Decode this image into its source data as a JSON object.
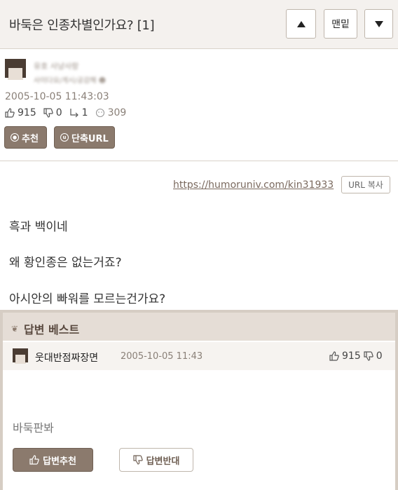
{
  "header": {
    "title": "바둑은 인종차별인가요? [1]",
    "bottom_label": "맨밑"
  },
  "post": {
    "author_name": "유호 사냥사랑",
    "author_sub": "사이다요/게시/공감해 ☻",
    "date": "2005-10-05 11:43:03",
    "likes": "915",
    "dislikes": "0",
    "shares": "1",
    "views": "309",
    "recommend_label": "추천",
    "short_url_label": "단축URL",
    "url": "https://humoruniv.com/kin31933",
    "copy_url_label": "URL 복사",
    "body": [
      "흑과 백이네",
      "왜 황인종은 없는거죠?",
      "아시안의 빠워를 모르는건가요?"
    ]
  },
  "best_answer": {
    "section_title": "답변 베스트",
    "author": "웃대반점짜장면",
    "date": "2005-10-05 11:43",
    "likes": "915",
    "dislikes": "0",
    "text": "바둑판봐",
    "upvote_label": "답변추천",
    "downvote_label": "답변반대"
  },
  "colors": {
    "accent": "#8b7a6d",
    "header_bg": "#f4f1ee",
    "best_header_bg": "#e5ddd6"
  }
}
